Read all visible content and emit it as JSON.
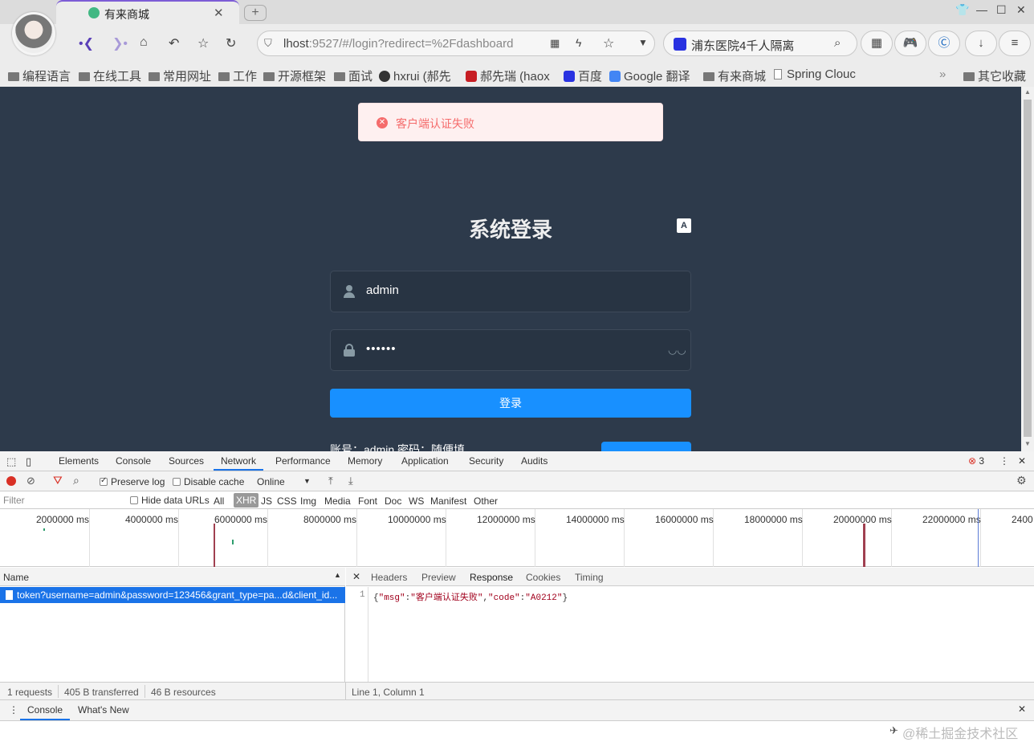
{
  "browser": {
    "tab_title": "有来商城",
    "url_prefix": "lhost",
    "url_rest": ":9527/#/login?redirect=%2Fdashboard",
    "search_text": "浦东医院4千人隔离",
    "bookmarks": [
      "编程语言",
      "在线工具",
      "常用网址",
      "工作",
      "开源框架",
      "面试",
      "hxrui (郝先",
      "郝先瑞 (haox",
      "百度",
      "Google 翻译",
      "有来商城",
      "Spring Clouc"
    ],
    "other_bookmarks": "其它收藏",
    "overflow": "»"
  },
  "page": {
    "error_message": "客户端认证失败",
    "login_title": "系统登录",
    "lang_icon_text": "A",
    "username": "admin",
    "password_mask": "••••••",
    "login_button": "登录",
    "tips": "账号：admin    密码：随便填"
  },
  "devtools": {
    "tabs": [
      "Elements",
      "Console",
      "Sources",
      "Network",
      "Performance",
      "Memory",
      "Application",
      "Security",
      "Audits"
    ],
    "active_tab": "Network",
    "error_count": "3",
    "preserve_log": "Preserve log",
    "disable_cache": "Disable cache",
    "throttle": "Online",
    "filter_placeholder": "Filter",
    "hide_data_urls": "Hide data URLs",
    "type_filters": [
      "All",
      "XHR",
      "JS",
      "CSS",
      "Img",
      "Media",
      "Font",
      "Doc",
      "WS",
      "Manifest",
      "Other"
    ],
    "active_filter": "XHR",
    "timeline_labels": [
      "2000000 ms",
      "4000000 ms",
      "6000000 ms",
      "8000000 ms",
      "10000000 ms",
      "12000000 ms",
      "14000000 ms",
      "16000000 ms",
      "18000000 ms",
      "20000000 ms",
      "22000000 ms",
      "2400"
    ],
    "name_header": "Name",
    "request_name": "token?username=admin&password=123456&grant_type=pa...d&client_id...",
    "detail_tabs": [
      "Headers",
      "Preview",
      "Response",
      "Cookies",
      "Timing"
    ],
    "active_detail_tab": "Response",
    "line_number": "1",
    "response_json": {
      "open": "{",
      "k1": "\"msg\"",
      "v1": "\"客户端认证失败\"",
      "k2": "\"code\"",
      "v2": "\"A0212\"",
      "close": "}"
    },
    "status_requests": "1 requests",
    "status_transferred": "405 B transferred",
    "status_resources": "46 B resources",
    "cursor_position": "Line 1, Column 1",
    "drawer_tabs": [
      "Console",
      "What's New"
    ],
    "watermark": "@稀土掘金技术社区"
  },
  "colors": {
    "page_bg": "#2d3a4b",
    "primary": "#1890ff",
    "error": "#f56c6c",
    "selection": "#1a73e8"
  }
}
